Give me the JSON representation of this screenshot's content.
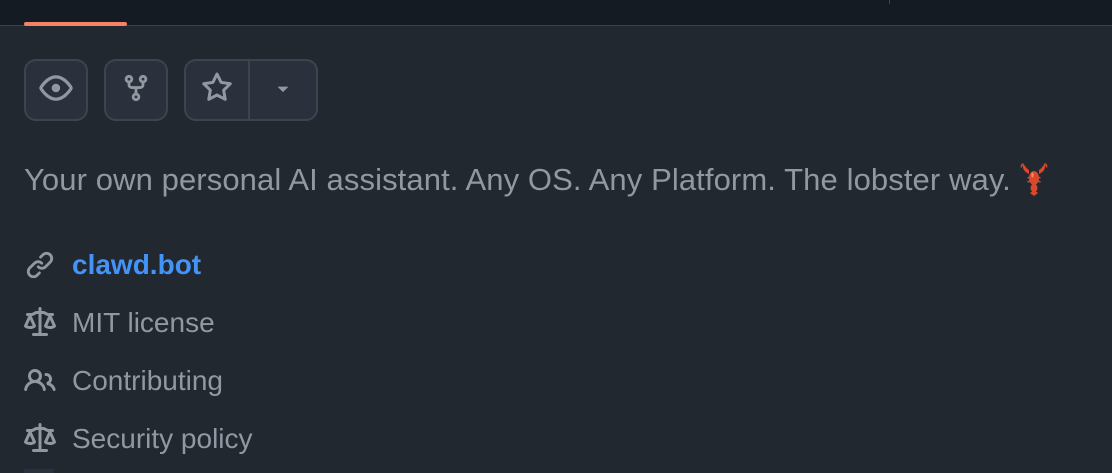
{
  "header": {
    "active_tab_color": "#f78166"
  },
  "actions": {
    "watch": {
      "icon": "eye-icon"
    },
    "fork": {
      "icon": "repo-forked-icon"
    },
    "star": {
      "icon": "star-icon"
    },
    "star_menu": {
      "icon": "triangle-down-icon"
    }
  },
  "about": {
    "description": "Your own personal AI assistant. Any OS. Any Platform. The lobster way.",
    "description_emoji": "lobster-emoji",
    "links": [
      {
        "icon": "link-icon",
        "label": "clawd.bot",
        "is_link": true
      },
      {
        "icon": "law-icon",
        "label": "MIT license"
      },
      {
        "icon": "people-icon",
        "label": "Contributing"
      },
      {
        "icon": "law-icon",
        "label": "Security policy"
      }
    ]
  },
  "colors": {
    "background": "#212830",
    "text_muted": "#9198a1",
    "link": "#4493f8",
    "border": "#3d444d"
  }
}
